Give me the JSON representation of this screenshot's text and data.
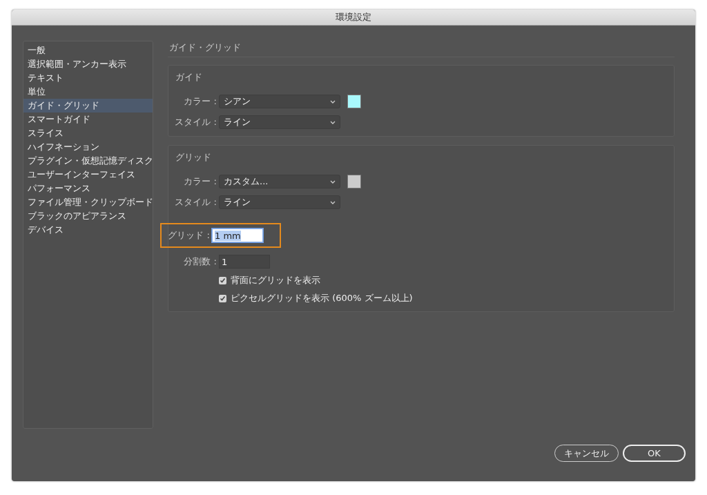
{
  "window": {
    "title": "環境設定"
  },
  "sidebar": {
    "items": [
      {
        "label": "一般",
        "selected": false
      },
      {
        "label": "選択範囲・アンカー表示",
        "selected": false
      },
      {
        "label": "テキスト",
        "selected": false
      },
      {
        "label": "単位",
        "selected": false
      },
      {
        "label": "ガイド・グリッド",
        "selected": true
      },
      {
        "label": "スマートガイド",
        "selected": false
      },
      {
        "label": "スライス",
        "selected": false
      },
      {
        "label": "ハイフネーション",
        "selected": false
      },
      {
        "label": "プラグイン・仮想記憶ディスク",
        "selected": false
      },
      {
        "label": "ユーザーインターフェイス",
        "selected": false
      },
      {
        "label": "パフォーマンス",
        "selected": false
      },
      {
        "label": "ファイル管理・クリップボード",
        "selected": false
      },
      {
        "label": "ブラックのアピアランス",
        "selected": false
      },
      {
        "label": "デバイス",
        "selected": false
      }
    ]
  },
  "panel": {
    "title": "ガイド・グリッド",
    "groups": [
      {
        "title": "ガイド",
        "rows": [
          {
            "kind": "dropdown",
            "label": "カラー :",
            "value": "シアン",
            "color": "#a9f8fc"
          },
          {
            "kind": "dropdown",
            "label": "スタイル :",
            "value": "ライン"
          }
        ]
      },
      {
        "title": "グリッド",
        "rows": [
          {
            "kind": "dropdown",
            "label": "カラー :",
            "value": "カスタム...",
            "color": "#cccccc"
          },
          {
            "kind": "dropdown",
            "label": "スタイル :",
            "value": "ライン"
          },
          {
            "kind": "text",
            "label": "グリッド :",
            "value": "1 mm",
            "focused": true,
            "highlighted": true
          },
          {
            "kind": "text",
            "label": "分割数 :",
            "value": "1",
            "focused": false,
            "highlighted": false
          },
          {
            "kind": "checkbox",
            "label": "背面にグリッドを表示",
            "checked": true
          },
          {
            "kind": "checkbox",
            "label": "ピクセルグリッドを表示 (600% ズーム以上)",
            "checked": true
          }
        ]
      }
    ]
  },
  "buttons": [
    {
      "label": "キャンセル",
      "default": false
    },
    {
      "label": "OK",
      "default": true
    }
  ]
}
